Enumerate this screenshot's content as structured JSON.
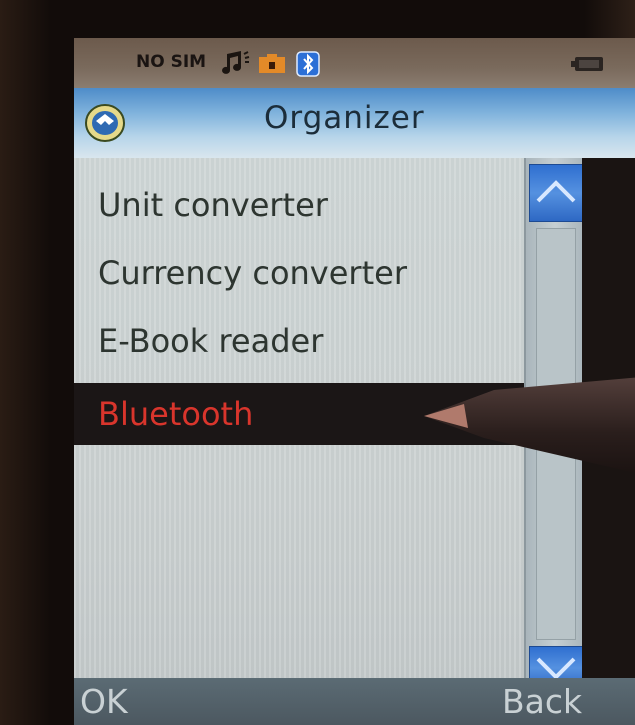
{
  "status_bar": {
    "carrier_text": "NO SIM",
    "icons": [
      "music-note-icon",
      "memory-card-icon",
      "bluetooth-icon",
      "battery-icon"
    ]
  },
  "title_bar": {
    "title": "Organizer",
    "app_icon": "organizer-globe-icon"
  },
  "menu": {
    "items": [
      {
        "label": "Unit converter",
        "selected": false
      },
      {
        "label": "Currency converter",
        "selected": false
      },
      {
        "label": "E-Book reader",
        "selected": false
      },
      {
        "label": "Bluetooth",
        "selected": true
      }
    ]
  },
  "scrollbar": {
    "up_icon": "chevron-up-icon",
    "down_icon": "chevron-down-icon"
  },
  "softkeys": {
    "left": "OK",
    "right": "Back"
  },
  "colors": {
    "title_gradient_top": "#4e8cc9",
    "selection_bg": "#1b1616",
    "selection_text": "#d9352c",
    "scroll_button": "#2f6fd0"
  }
}
